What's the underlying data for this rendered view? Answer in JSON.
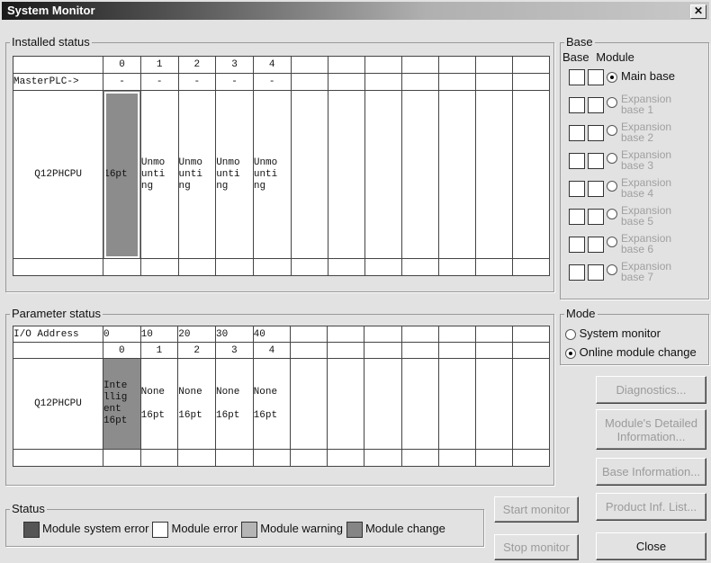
{
  "window": {
    "title": "System Monitor",
    "close_glyph": "✕"
  },
  "installed": {
    "label": "Installed status",
    "slot_headers": [
      "0",
      "1",
      "2",
      "3",
      "4"
    ],
    "master_label": "MasterPLC->",
    "master_values": [
      "-",
      "-",
      "-",
      "-",
      "-"
    ],
    "cpu": "Q12PHCPU",
    "slots": [
      "16pt",
      "Unmo unti ng",
      "Unmo unti ng",
      "Unmo unti ng",
      "Unmo unti ng"
    ],
    "slot_lines": [
      [
        "16pt"
      ],
      [
        "Unmo",
        "unti",
        "ng"
      ],
      [
        "Unmo",
        "unti",
        "ng"
      ],
      [
        "Unmo",
        "unti",
        "ng"
      ],
      [
        "Unmo",
        "unti",
        "ng"
      ]
    ]
  },
  "base": {
    "label": "Base",
    "col_base": "Base",
    "col_module": "Module",
    "items": [
      {
        "label": [
          "Main base"
        ],
        "selected": true,
        "enabled": true
      },
      {
        "label": [
          "Expansion",
          "base 1"
        ],
        "selected": false,
        "enabled": false
      },
      {
        "label": [
          "Expansion",
          "base 2"
        ],
        "selected": false,
        "enabled": false
      },
      {
        "label": [
          "Expansion",
          "base 3"
        ],
        "selected": false,
        "enabled": false
      },
      {
        "label": [
          "Expansion",
          "base 4"
        ],
        "selected": false,
        "enabled": false
      },
      {
        "label": [
          "Expansion",
          "base 5"
        ],
        "selected": false,
        "enabled": false
      },
      {
        "label": [
          "Expansion",
          "base 6"
        ],
        "selected": false,
        "enabled": false
      },
      {
        "label": [
          "Expansion",
          "base 7"
        ],
        "selected": false,
        "enabled": false
      }
    ]
  },
  "parameter": {
    "label": "Parameter status",
    "io_label": "I/O Address",
    "io_values": [
      "0",
      "10",
      "20",
      "30",
      "40"
    ],
    "slot_headers": [
      "0",
      "1",
      "2",
      "3",
      "4"
    ],
    "cpu": "Q12PHCPU",
    "slot_lines": [
      [
        "Inte",
        "llig",
        "ent",
        "16pt"
      ],
      [
        "None",
        "",
        "16pt"
      ],
      [
        "None",
        "",
        "16pt"
      ],
      [
        "None",
        "",
        "16pt"
      ],
      [
        "None",
        "",
        "16pt"
      ]
    ]
  },
  "mode": {
    "label": "Mode",
    "options": [
      {
        "label": "System monitor",
        "selected": false
      },
      {
        "label": "Online module change",
        "selected": true
      }
    ]
  },
  "buttons": {
    "diagnostics": "Diagnostics...",
    "module_detail": "Module's Detailed Information...",
    "base_info": "Base Information...",
    "product_list": "Product Inf. List...",
    "start_monitor": "Start monitor",
    "stop_monitor": "Stop monitor",
    "close": "Close"
  },
  "status": {
    "label": "Status",
    "items": [
      {
        "label": "Module system error",
        "color": "#555555"
      },
      {
        "label": "Module error",
        "color": "#ffffff"
      },
      {
        "label": "Module warning",
        "color": "#b5b5b5"
      },
      {
        "label": "Module change",
        "color": "#858585"
      }
    ]
  }
}
